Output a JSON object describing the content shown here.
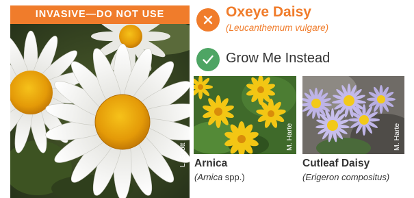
{
  "invasive": {
    "banner": "INVASIVE—DO NOT USE",
    "common_name": "Oxeye Daisy",
    "scientific_name": "(Leucanthemum vulgare)",
    "photo_credit": "L. Scott",
    "status_icon": "x-icon"
  },
  "alternatives": {
    "heading": "Grow Me Instead",
    "status_icon": "check-icon",
    "items": [
      {
        "common_name": "Arnica",
        "scientific_genus": "(Arnica",
        "scientific_suffix": " spp.)",
        "photo_credit": "M. Harte"
      },
      {
        "common_name": "Cutleaf Daisy",
        "scientific_name": "(Erigeron compositus)",
        "photo_credit": "M. Harte"
      }
    ]
  },
  "colors": {
    "invasive_accent": "#f07c2b",
    "native_accent": "#4ea564",
    "text": "#333333"
  }
}
